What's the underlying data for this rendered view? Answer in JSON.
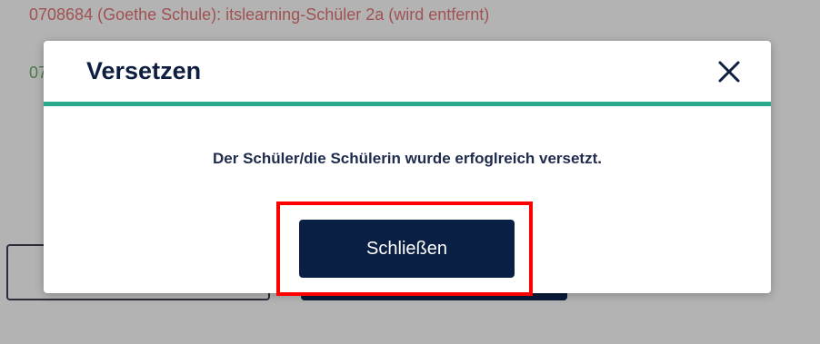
{
  "background": {
    "line1": "0708684 (Goethe Schule): itslearning-Schüler 2a (wird entfernt)",
    "line2": "07"
  },
  "dialog": {
    "title": "Versetzen",
    "close_icon": "close-icon",
    "message": "Der Schüler/die Schülerin wurde erfoglreich versetzt.",
    "close_button_label": "Schließen"
  },
  "colors": {
    "accent_divider": "#2aa98a",
    "primary_button": "#0a1f44",
    "title_text": "#0e1e40",
    "highlight_box": "#ff0000"
  }
}
